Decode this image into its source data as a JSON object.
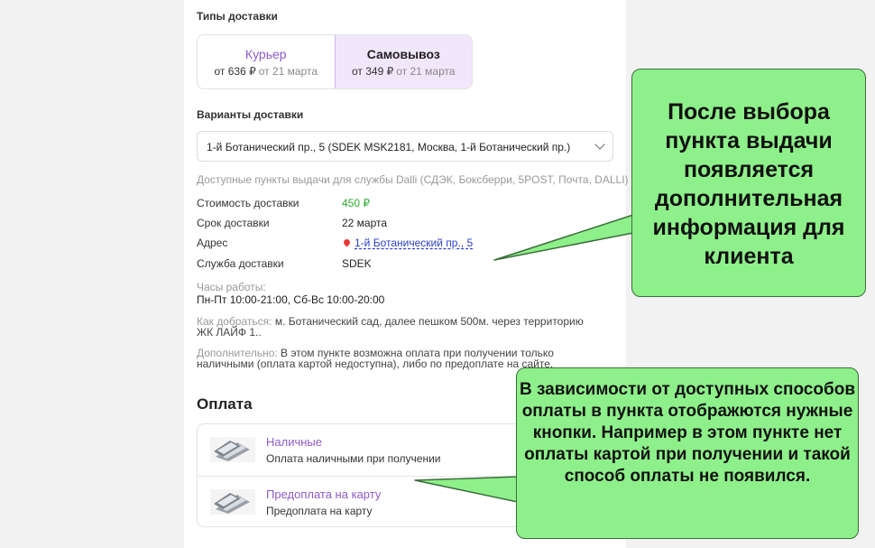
{
  "delivery_types": {
    "heading": "Типы доставки",
    "options": [
      {
        "title": "Курьер",
        "price": "от 636 ₽",
        "date": "от 21 марта",
        "selected": false
      },
      {
        "title": "Самовывоз",
        "price": "от 349 ₽",
        "date": "от 21 марта",
        "selected": true
      }
    ]
  },
  "delivery_variants": {
    "heading": "Варианты доставки",
    "selected_value": "1-й Ботанический пр., 5 (SDEK MSK2181, Москва, 1-й Ботанический пр.)",
    "available_note": "Доступные пункты выдачи для службы Dalli (СДЭК, Боксберри, 5POST, Почта, DALLI)"
  },
  "details": {
    "cost_label": "Стоимость доставки",
    "cost_value": "450 ₽",
    "term_label": "Срок доставки",
    "term_value": "22 марта",
    "address_label": "Адрес",
    "address_value": "1-й Ботанический пр., 5",
    "service_label": "Служба доставки",
    "service_value": "SDEK",
    "hours_label": "Часы работы:",
    "hours_value": "Пн-Пт 10:00-21:00, Сб-Вс 10:00-20:00",
    "route_label": "Как добраться:",
    "route_value": "м. Ботанический сад, далее пешком 500м. через территорию ЖК ЛАЙФ 1..",
    "extra_label": "Дополнительно:",
    "extra_value": "В этом пункте возможна оплата при получении только наличными (оплата картой недоступна), либо по предоплате на сайте."
  },
  "payment": {
    "heading": "Оплата",
    "methods": [
      {
        "title": "Наличные",
        "subtitle": "Оплата наличными при получении"
      },
      {
        "title": "Предоплата на карту",
        "subtitle": "Предоплата на карту"
      }
    ]
  },
  "callouts": {
    "first": "После выбора пункта выдачи появляется дополнительная информация для клиента",
    "second": "В зависимости от доступных способов оплаты в пункта отображются нужные кнопки. Например в этом пункте нет оплаты картой при получении и такой способ оплаты не появился."
  },
  "colors": {
    "accent": "#8e5bc8",
    "selected_bg": "#f1e7fb",
    "price_green": "#2eaa2e",
    "callout_bg": "#8ef08a"
  }
}
